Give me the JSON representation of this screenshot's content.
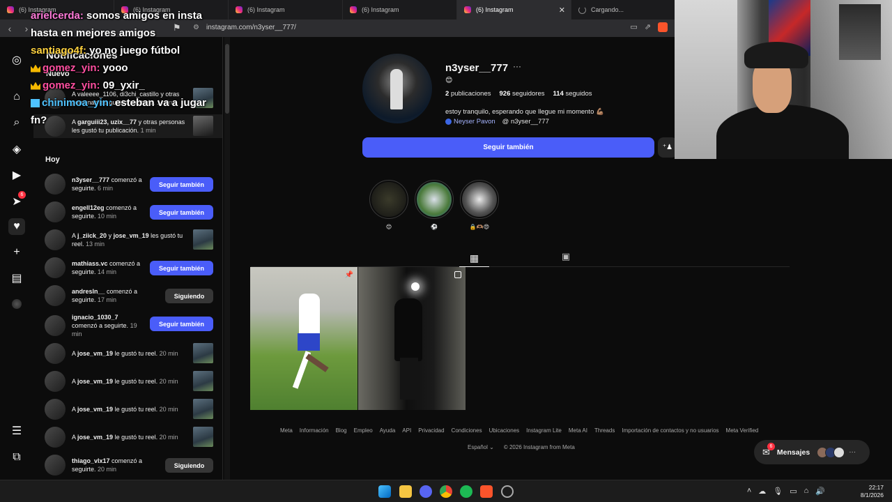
{
  "browser": {
    "tabs": [
      {
        "label": "(6) Instagram"
      },
      {
        "label": "(6) Instagram"
      },
      {
        "label": "(6) Instagram"
      },
      {
        "label": "(6) Instagram"
      },
      {
        "label": "(6) Instagram"
      },
      {
        "label": "Cargando..."
      }
    ],
    "url": "instagram.com/n3yser__777/"
  },
  "chat": {
    "lines": [
      {
        "user": "arielcerda:",
        "message": " somos amigos en insta"
      },
      {
        "user": "",
        "message": "hasta en mejores amigos"
      },
      {
        "user": "santiago4f:",
        "message": " yo no juego fútbol"
      },
      {
        "user": "gomez_yin:",
        "message": " yooo"
      },
      {
        "user": "gomez_yin:",
        "message": " 09_yxir_"
      },
      {
        "user": "chinimoa_yin:",
        "message": " esteban va a jugar"
      },
      {
        "user": "",
        "message": "fn?"
      }
    ]
  },
  "notifications": {
    "title": "Notificaciones",
    "new_label": "Nuevo",
    "today_label": "Hoy",
    "new_items": [
      {
        "text": "A valeeee_1106, di3chi_castillo y otras personas les gustó tu historia.",
        "time": "1 min"
      },
      {
        "users": "garguiii23, uzix__77",
        "text": " y otras personas les gustó tu publicación.",
        "prefix": "A ",
        "time": "1 min"
      }
    ],
    "today_items": [
      {
        "user": "n3yser__777",
        "text": " comenzó a seguirte.",
        "time": "6 min",
        "action": "Seguir también"
      },
      {
        "user": "engell12eg",
        "text": " comenzó a seguirte.",
        "time": "10 min",
        "action": "Seguir también"
      },
      {
        "prefix": "A ",
        "user": "j_ziick_20",
        "mid": " y ",
        "user2": "jose_vm_19",
        "text": " les gustó tu reel.",
        "time": "13 min",
        "action": ""
      },
      {
        "user": "mathiass.vc",
        "text": " comenzó a seguirte.",
        "time": "14 min",
        "action": "Seguir también"
      },
      {
        "user": "andresln__",
        "text": " comenzó a seguirte.",
        "time": "17 min",
        "action": "Siguiendo"
      },
      {
        "user": "ignacio_1030_7",
        "text": " comenzó a seguirte.",
        "time": "19 min",
        "action": "Seguir también"
      },
      {
        "prefix": "A ",
        "user": "jose_vm_19",
        "text": " le gustó tu reel.",
        "time": "20 min",
        "action": ""
      },
      {
        "prefix": "A ",
        "user": "jose_vm_19",
        "text": " le gustó tu reel.",
        "time": "20 min",
        "action": ""
      },
      {
        "prefix": "A ",
        "user": "jose_vm_19",
        "text": " le gustó tu reel.",
        "time": "20 min",
        "action": ""
      },
      {
        "prefix": "A ",
        "user": "jose_vm_19",
        "text": " le gustó tu reel.",
        "time": "20 min",
        "action": ""
      },
      {
        "user": "thiago_vlx17",
        "text": " comenzó a seguirte.",
        "time": "20 min",
        "action": "Siguiendo"
      }
    ]
  },
  "sidebar_icons": [
    "instagram-icon",
    "home-icon",
    "search-icon",
    "explore-icon",
    "reels-icon",
    "messages-icon",
    "notifications-icon",
    "create-icon",
    "dashboard-icon",
    "profile-icon",
    "menu-icon",
    "apps-icon"
  ],
  "sidebar_badge": "6",
  "profile": {
    "username": "n3yser__777",
    "emoji": "😊",
    "posts": "2",
    "posts_label": "publicaciones",
    "followers": "926",
    "followers_label": "seguidores",
    "following": "114",
    "following_label": "seguidos",
    "bio": "estoy tranquilo, esperando que llegue mi momento 💪🏽",
    "facebook": "Neyser Pavon",
    "threads": "n3yser__777",
    "follow_back": "Seguir también",
    "highlights": [
      {
        "label": "😊"
      },
      {
        "label": "⚽"
      },
      {
        "label": "🔒🫶🏽😍"
      }
    ]
  },
  "footer": {
    "links": [
      "Meta",
      "Información",
      "Blog",
      "Empleo",
      "Ayuda",
      "API",
      "Privacidad",
      "Condiciones",
      "Ubicaciones",
      "Instagram Lite",
      "Meta AI",
      "Threads",
      "Importación de contactos y no usuarios",
      "Meta Verified"
    ],
    "language": "Español",
    "copyright": "© 2026 Instagram from Meta"
  },
  "messages": {
    "label": "Mensajes",
    "badge": "6"
  },
  "taskbar": {
    "time": "22:17",
    "date": "8/1/2026"
  }
}
